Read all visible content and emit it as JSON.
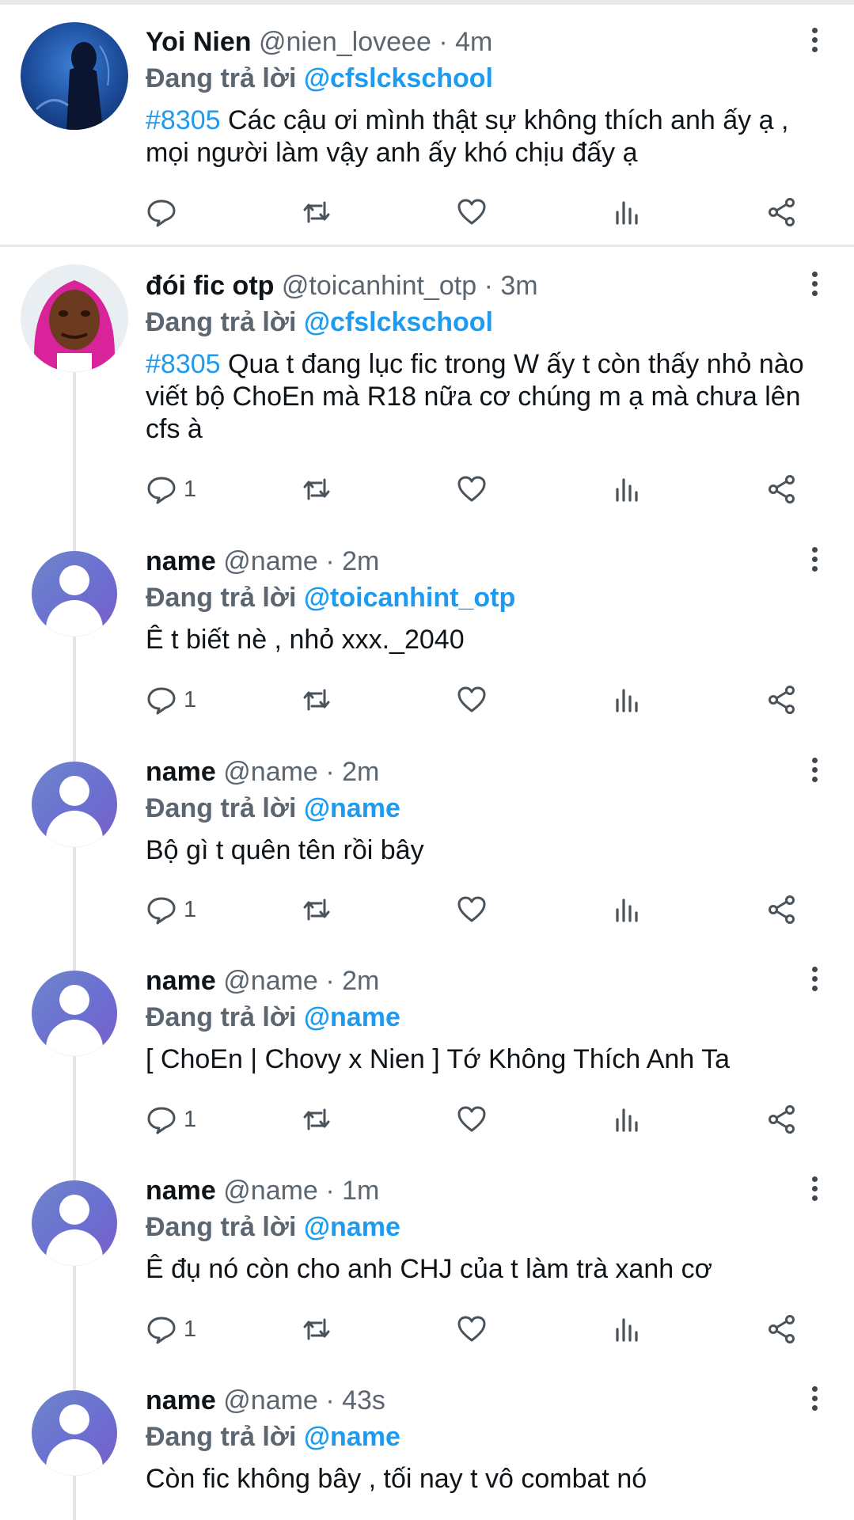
{
  "replying_prefix": "Đang trả lời",
  "tweets": [
    {
      "name": "Yoi Nien",
      "handle": "@nien_loveee",
      "time": "4m",
      "reply_to": "@cfslckschool",
      "tag": "#8305",
      "text": " Các cậu ơi mình thật sự không thích anh ấy ạ , mọi người làm vậy anh ấy khó chịu đấy ạ",
      "reply_count": ""
    },
    {
      "name": "đói fic otp",
      "handle": "@toicanhint_otp",
      "time": "3m",
      "reply_to": "@cfslckschool",
      "tag": "#8305",
      "text": " Qua t đang lục fic trong W ấy t còn thấy nhỏ nào viết bộ ChoEn mà R18 nữa cơ chúng m ạ mà chưa lên cfs à",
      "reply_count": "1"
    },
    {
      "name": "name",
      "handle": "@name",
      "time": "2m",
      "reply_to": "@toicanhint_otp",
      "tag": "",
      "text": "Ê t biết nè , nhỏ xxx._2040",
      "reply_count": "1"
    },
    {
      "name": "name",
      "handle": "@name",
      "time": "2m",
      "reply_to": "@name",
      "tag": "",
      "text": "Bộ gì t quên tên rồi bây",
      "reply_count": "1"
    },
    {
      "name": "name",
      "handle": "@name",
      "time": "2m",
      "reply_to": "@name",
      "tag": "",
      "text": "[ ChoEn | Chovy x Nien ] Tớ Không Thích Anh Ta",
      "reply_count": "1"
    },
    {
      "name": "name",
      "handle": "@name",
      "time": "1m",
      "reply_to": "@name",
      "tag": "",
      "text": "Ê đụ nó còn cho anh CHJ của t làm trà xanh cơ",
      "reply_count": "1"
    },
    {
      "name": "name",
      "handle": "@name",
      "time": "43s",
      "reply_to": "@name",
      "tag": "",
      "text": "Còn fic không bây , tối nay t vô combat nó",
      "reply_count": ""
    }
  ]
}
